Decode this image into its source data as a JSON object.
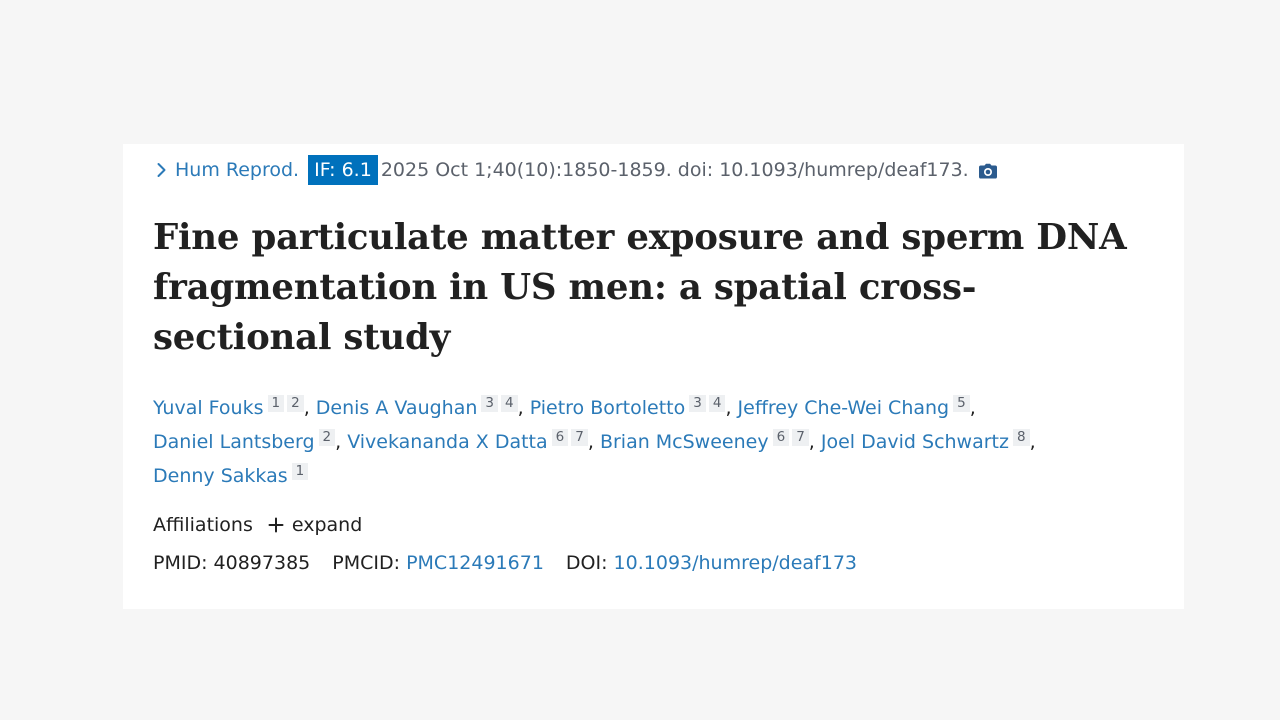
{
  "citation": {
    "journal": "Hum Reprod.",
    "impact_factor": "IF: 6.1",
    "details": "2025 Oct 1;40(10):1850-1859. doi: 10.1093/humrep/deaf173."
  },
  "title": "Fine particulate matter exposure and sperm DNA fragmentation in US men: a spatial cross-sectional study",
  "authors": [
    {
      "name": "Yuval Fouks",
      "affiliations": [
        "1",
        "2"
      ]
    },
    {
      "name": "Denis A Vaughan",
      "affiliations": [
        "3",
        "4"
      ]
    },
    {
      "name": "Pietro Bortoletto",
      "affiliations": [
        "3",
        "4"
      ]
    },
    {
      "name": "Jeffrey Che-Wei Chang",
      "affiliations": [
        "5"
      ]
    },
    {
      "name": "Daniel Lantsberg",
      "affiliations": [
        "2"
      ]
    },
    {
      "name": "Vivekananda X Datta",
      "affiliations": [
        "6",
        "7"
      ]
    },
    {
      "name": "Brian McSweeney",
      "affiliations": [
        "6",
        "7"
      ]
    },
    {
      "name": "Joel David Schwartz",
      "affiliations": [
        "8"
      ]
    },
    {
      "name": "Denny Sakkas",
      "affiliations": [
        "1"
      ]
    }
  ],
  "affiliations_section": {
    "label": "Affiliations",
    "expand_label": "expand"
  },
  "identifiers": {
    "pmid_label": "PMID:",
    "pmid": "40897385",
    "pmcid_label": "PMCID:",
    "pmcid": "PMC12491671",
    "doi_label": "DOI:",
    "doi": "10.1093/humrep/deaf173"
  },
  "colors": {
    "link": "#2b7ab8",
    "badge_bg": "#0071bc",
    "page_bg": "#f6f6f6"
  },
  "icons": {
    "chevron": "chevron-right-icon",
    "camera": "camera-icon",
    "plus": "plus-icon"
  }
}
